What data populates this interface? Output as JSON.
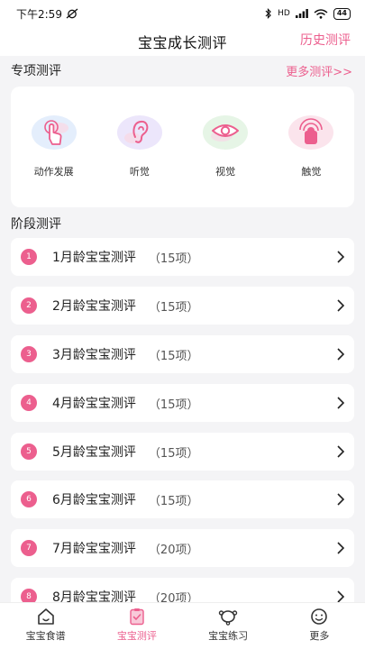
{
  "status": {
    "time": "下午2:59",
    "network": "HD",
    "battery": "44"
  },
  "header": {
    "title": "宝宝成长测评",
    "history_label": "历史测评"
  },
  "special": {
    "title": "专项测评",
    "more_label": "更多测评>>",
    "items": [
      {
        "label": "动作发展",
        "icon": "hand-touch-icon"
      },
      {
        "label": "听觉",
        "icon": "ear-icon"
      },
      {
        "label": "视觉",
        "icon": "eye-icon"
      },
      {
        "label": "触觉",
        "icon": "touch-icon"
      }
    ]
  },
  "stage": {
    "title": "阶段测评",
    "rows": [
      {
        "num": "1",
        "title": "1月龄宝宝测评",
        "count": "（15项）"
      },
      {
        "num": "2",
        "title": "2月龄宝宝测评",
        "count": "（15项）"
      },
      {
        "num": "3",
        "title": "3月龄宝宝测评",
        "count": "（15项）"
      },
      {
        "num": "4",
        "title": "4月龄宝宝测评",
        "count": "（15项）"
      },
      {
        "num": "5",
        "title": "5月龄宝宝测评",
        "count": "（15项）"
      },
      {
        "num": "6",
        "title": "6月龄宝宝测评",
        "count": "（15项）"
      },
      {
        "num": "7",
        "title": "7月龄宝宝测评",
        "count": "（20项）"
      },
      {
        "num": "8",
        "title": "8月龄宝宝测评",
        "count": "（20项）"
      }
    ]
  },
  "tabbar": {
    "items": [
      {
        "label": "宝宝食谱",
        "icon": "home-icon",
        "active": false
      },
      {
        "label": "宝宝测评",
        "icon": "clipboard-icon",
        "active": true
      },
      {
        "label": "宝宝练习",
        "icon": "practice-icon",
        "active": false
      },
      {
        "label": "更多",
        "icon": "smiley-icon",
        "active": false
      }
    ]
  },
  "colors": {
    "accent": "#ec5f8e",
    "background": "#f4f4f6"
  }
}
